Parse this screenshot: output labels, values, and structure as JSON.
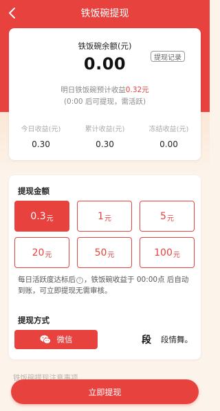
{
  "header": {
    "title": "铁饭碗提现"
  },
  "balance_card": {
    "label": "铁饭碗余额(元)",
    "record_button": "提现记录",
    "amount": "0.00",
    "predict_prefix": "明日铁饭碗预计收益",
    "predict_value": "0.32元",
    "predict_note": "(0:00 后可提现，需活跃)",
    "stats": [
      {
        "label": "今日收益(元)",
        "value": "0.30"
      },
      {
        "label": "累计收益(元)",
        "value": "0.30"
      },
      {
        "label": "冻结收益(元)",
        "value": "0.00"
      }
    ]
  },
  "withdraw": {
    "amount_title": "提现金额",
    "options": [
      {
        "num": "0.3",
        "unit": "元",
        "selected": true
      },
      {
        "num": "1",
        "unit": "元",
        "selected": false
      },
      {
        "num": "5",
        "unit": "元",
        "selected": false
      },
      {
        "num": "20",
        "unit": "元",
        "selected": false
      },
      {
        "num": "50",
        "unit": "元",
        "selected": false
      },
      {
        "num": "100",
        "unit": "元",
        "selected": false
      }
    ],
    "tip_prefix": "每日活跃度达标后",
    "tip_suffix": "，铁饭碗收益于 00:00点 后自动到账，可立即提现无需审核。",
    "method_title": "提现方式",
    "methods": {
      "wechat": "微信",
      "alt": "段情舞。"
    }
  },
  "footer": {
    "obscured_text": "铁饭碗提现注意事项",
    "submit_label": "立即提现"
  },
  "colors": {
    "accent": "#e8423f",
    "background": "#fcf3ea"
  }
}
